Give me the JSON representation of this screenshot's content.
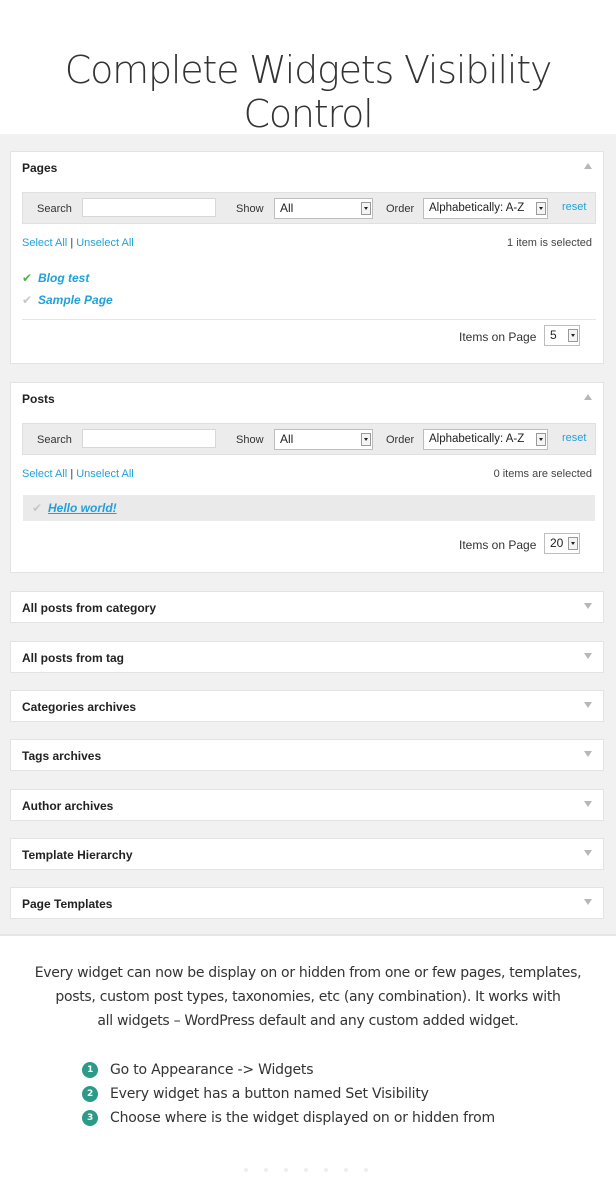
{
  "page_title": "Complete Widgets Visibility Control",
  "pages_panel": {
    "title": "Pages",
    "search_label": "Search",
    "show_label": "Show",
    "show_value": "All",
    "order_label": "Order",
    "order_value": "Alphabetically: A-Z",
    "reset_label": "reset",
    "select_all": "Select All",
    "separator": "|",
    "unselect_all": "Unselect All",
    "selected_count": "1 item is selected",
    "items": [
      {
        "label": "Blog test",
        "checked": true
      },
      {
        "label": "Sample Page",
        "checked": false
      }
    ],
    "items_on_page_label": "Items on Page",
    "items_on_page_value": "5"
  },
  "posts_panel": {
    "title": "Posts",
    "search_label": "Search",
    "show_label": "Show",
    "show_value": "All",
    "order_label": "Order",
    "order_value": "Alphabetically: A-Z",
    "reset_label": "reset",
    "select_all": "Select All",
    "separator": "|",
    "unselect_all": "Unselect All",
    "selected_count": "0 items are selected",
    "items": [
      {
        "label": "Hello world!",
        "checked": false
      }
    ],
    "items_on_page_label": "Items on Page",
    "items_on_page_value": "20"
  },
  "collapsed_panels": [
    "All posts from category",
    "All posts from tag",
    "Categories archives",
    "Tags archives",
    "Author archives",
    "Template Hierarchy",
    "Page Templates"
  ],
  "description": {
    "line1": "Every widget can now be display on or hidden from one or few pages, templates,",
    "line2": "posts, custom post types, taxonomies, etc (any combination). It works with",
    "line3": "all widgets – WordPress default and any custom added widget."
  },
  "steps": [
    {
      "num": "1",
      "text": "Go to Appearance -> Widgets"
    },
    {
      "num": "2",
      "text": "Every widget has a button named Set Visibility"
    },
    {
      "num": "3",
      "text": "Choose where is the widget displayed on or hidden from"
    }
  ],
  "check_glyph": "✔",
  "colors": {
    "accent": "#21a1db",
    "check": "#48b648",
    "step_badge": "#2b9b88"
  }
}
